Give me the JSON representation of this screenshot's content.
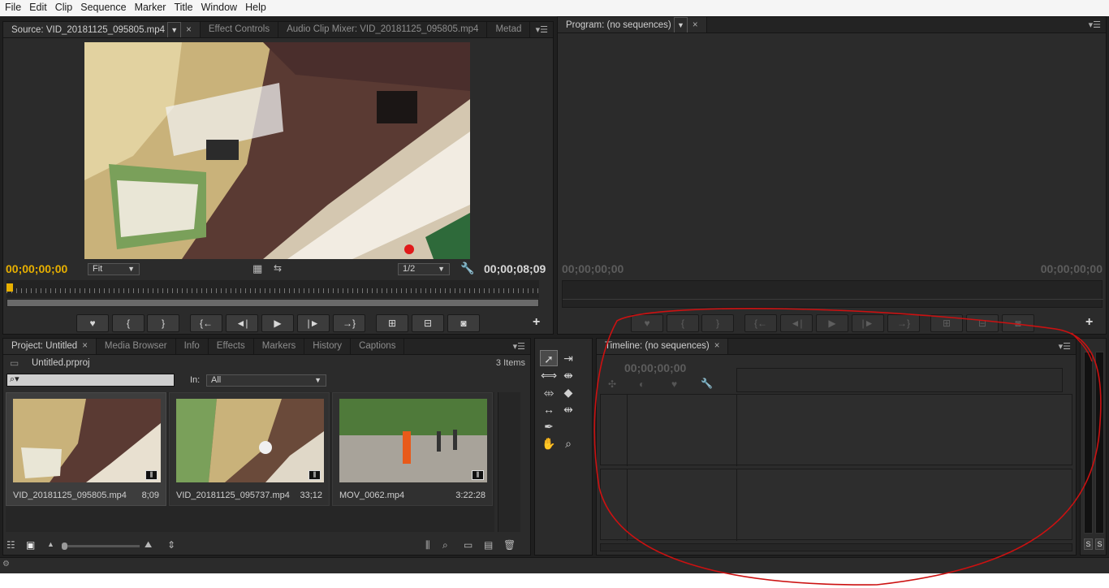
{
  "menu": [
    "File",
    "Edit",
    "Clip",
    "Sequence",
    "Marker",
    "Title",
    "Window",
    "Help"
  ],
  "source": {
    "tabs": [
      {
        "label": "Source: VID_20181125_095805.mp4",
        "active": true
      },
      {
        "label": "Effect Controls",
        "active": false
      },
      {
        "label": "Audio Clip Mixer: VID_20181125_095805.mp4",
        "active": false
      },
      {
        "label": "Metad",
        "active": false
      }
    ],
    "timecode_in": "00;00;00;00",
    "zoom": "Fit",
    "resolution": "1/2",
    "timecode_out": "00;00;08;09"
  },
  "program": {
    "tab": "Program: (no sequences)",
    "timecode_in": "00;00;00;00",
    "timecode_out": "00;00;00;00"
  },
  "transport": {
    "marker": "♥",
    "mark_in": "{",
    "mark_out": "}",
    "go_in": "{←",
    "step_back": "◄|",
    "play": "▶",
    "step_fwd": "|►",
    "go_out": "→}",
    "insert": "⊞",
    "overwrite": "⊟",
    "export": "◙",
    "add": "+"
  },
  "project": {
    "tabs": [
      {
        "label": "Project: Untitled",
        "active": true
      },
      {
        "label": "Media Browser",
        "active": false
      },
      {
        "label": "Info",
        "active": false
      },
      {
        "label": "Effects",
        "active": false
      },
      {
        "label": "Markers",
        "active": false
      },
      {
        "label": "History",
        "active": false
      },
      {
        "label": "Captions",
        "active": false
      }
    ],
    "file": "Untitled.prproj",
    "count": "3 Items",
    "search_placeholder": "",
    "in_label": "In:",
    "in_value": "All",
    "clips": [
      {
        "name": "VID_20181125_095805.mp4",
        "duration": "8;09"
      },
      {
        "name": "VID_20181125_095737.mp4",
        "duration": "33;12"
      },
      {
        "name": "MOV_0062.mp4",
        "duration": "3:22:28"
      }
    ]
  },
  "timeline": {
    "tab": "Timeline: (no sequences)",
    "timecode": "00;00;00;00"
  },
  "meter": {
    "solo_left": "S",
    "solo_right": "S"
  },
  "colors": {
    "accent_timecode": "#e8b000",
    "annotation_red": "#cc1111",
    "panel_bg": "#2b2b2b"
  }
}
